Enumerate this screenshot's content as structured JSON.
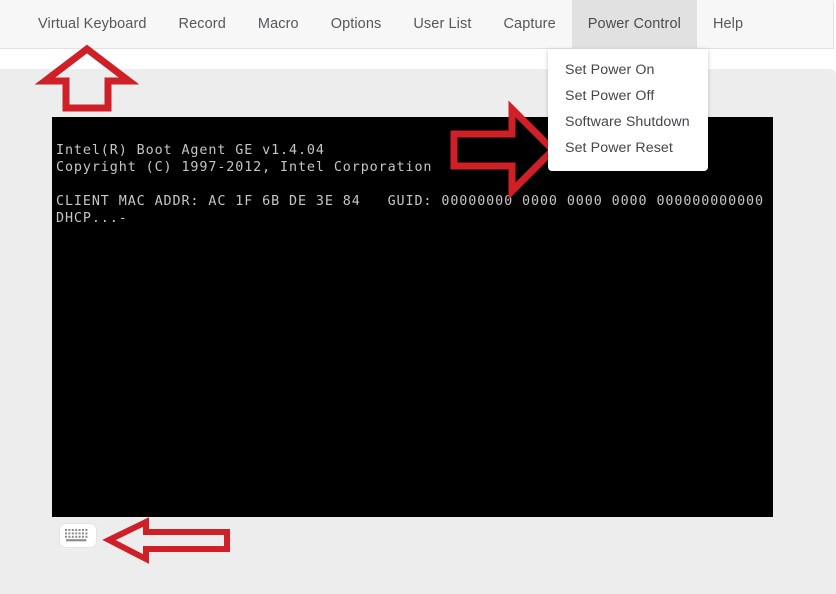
{
  "menubar": {
    "items": [
      {
        "label": "Virtual Keyboard",
        "active": false
      },
      {
        "label": "Record",
        "active": false
      },
      {
        "label": "Macro",
        "active": false
      },
      {
        "label": "Options",
        "active": false
      },
      {
        "label": "User List",
        "active": false
      },
      {
        "label": "Capture",
        "active": false
      },
      {
        "label": "Power Control",
        "active": true
      },
      {
        "label": "Help",
        "active": false
      }
    ]
  },
  "power_menu": {
    "items": [
      {
        "label": "Set Power On"
      },
      {
        "label": "Set Power Off"
      },
      {
        "label": "Software Shutdown"
      },
      {
        "label": "Set Power Reset"
      }
    ]
  },
  "terminal": {
    "lines": [
      "Intel(R) Boot Agent GE v1.4.04",
      "Copyright (C) 1997-2012, Intel Corporation",
      "",
      "CLIENT MAC ADDR: AC 1F 6B DE 3E 84   GUID: 00000000 0000 0000 0000 000000000000",
      "DHCP...-"
    ],
    "text": "Intel(R) Boot Agent GE v1.4.04\nCopyright (C) 1997-2012, Intel Corporation\n\nCLIENT MAC ADDR: AC 1F 6B DE 3E 84   GUID: 00000000 0000 0000 0000 000000000000\nDHCP...-"
  },
  "toolbar": {
    "virtual_keyboard_icon": "keyboard-icon"
  },
  "annotations": [
    {
      "name": "arrow-up-virtual-keyboard",
      "direction": "up"
    },
    {
      "name": "arrow-right-power-control-menu",
      "direction": "right"
    },
    {
      "name": "arrow-left-keyboard-icon",
      "direction": "left"
    }
  ],
  "colors": {
    "annotation_red": "#cf2027",
    "menubar_bg": "#f7f7f7",
    "menu_active_bg": "#e1e1e1",
    "content_bg": "#ededed",
    "terminal_bg": "#000000",
    "terminal_fg": "#c5c5c5"
  }
}
